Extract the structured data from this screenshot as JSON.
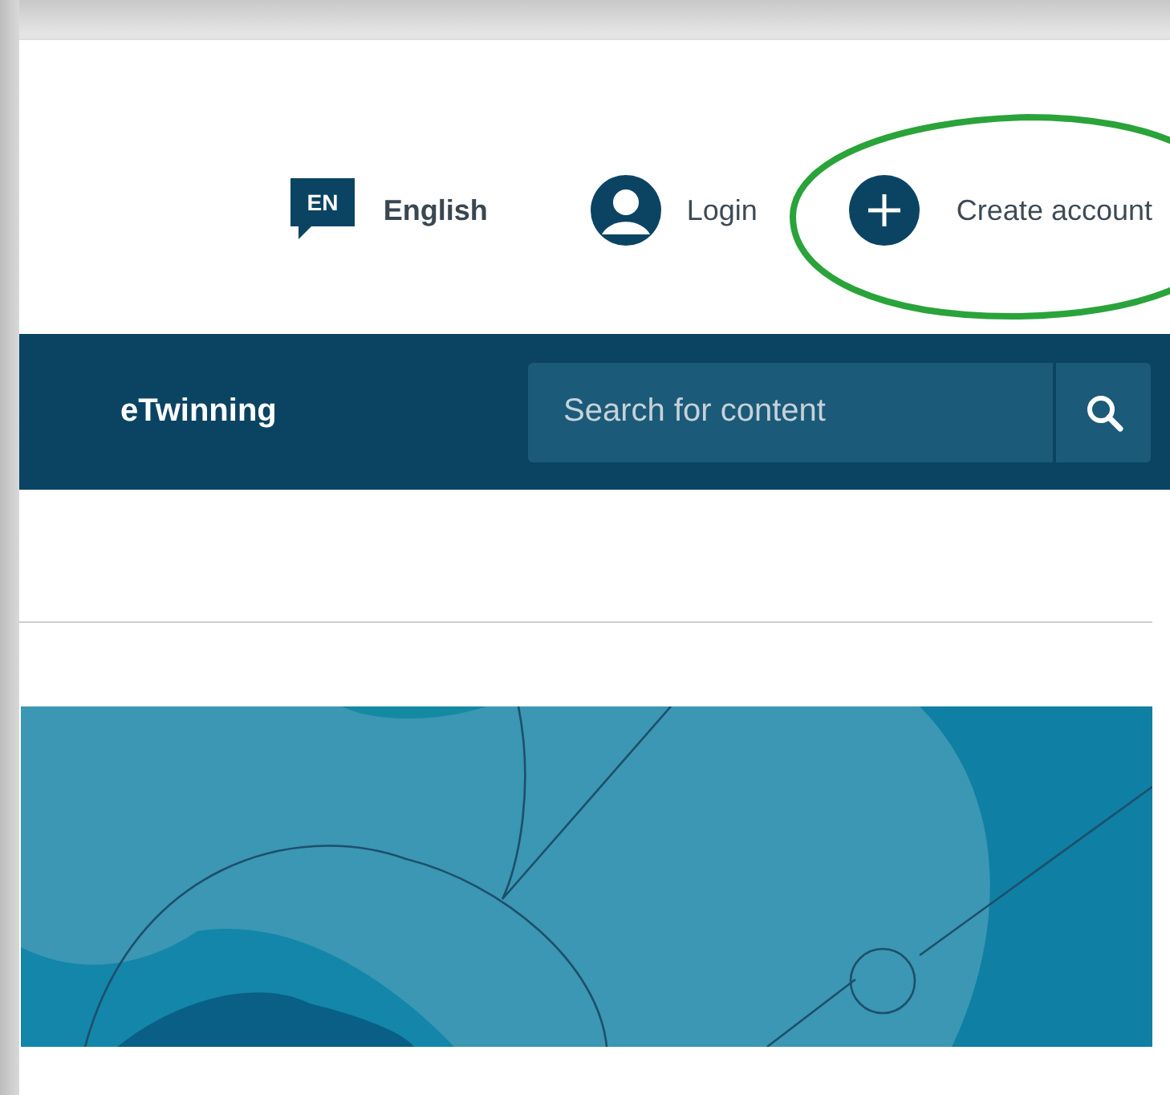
{
  "header": {
    "language": {
      "code": "EN",
      "label": "English"
    },
    "login": "Login",
    "create_account": "Create account",
    "highlighted": true
  },
  "nav": {
    "items": [
      {
        "label": "eTwinning"
      }
    ],
    "search": {
      "placeholder": "Search for content"
    }
  }
}
